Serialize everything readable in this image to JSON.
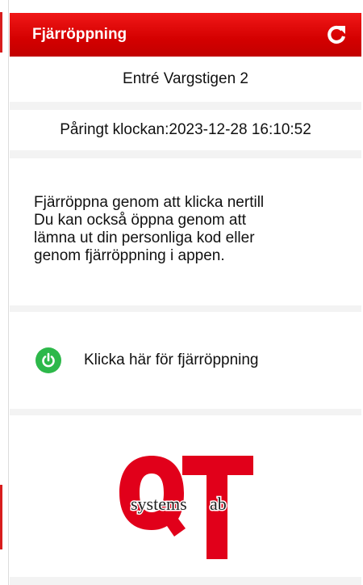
{
  "header": {
    "title": "Fjärröppning",
    "refresh_icon": "refresh-icon"
  },
  "entrance": {
    "name": "Entré Vargstigen 2"
  },
  "called": {
    "label": "Påringt klockan:",
    "datetime": "2023-12-28 16:10:52"
  },
  "info": {
    "lines": [
      "Fjärröppna genom att klicka nertill",
      "Du kan också öppna genom att",
      "lämna ut din personliga kod eller",
      "genom fjärröppning i appen."
    ]
  },
  "open_button": {
    "label": "Klicka här för fjärröppning",
    "icon": "power-icon",
    "color": "#2db84a"
  },
  "logo": {
    "letters": "QT",
    "text": "systems ab",
    "color": "#e1001a"
  },
  "colors": {
    "header": "#d40000",
    "background": "#f3f3f3"
  }
}
